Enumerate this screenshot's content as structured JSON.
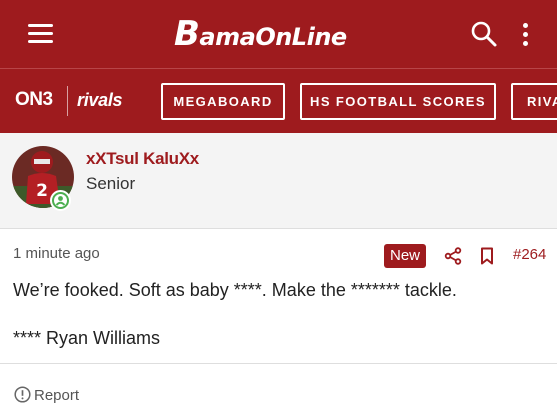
{
  "header": {
    "logo_text": "BamaOnLine",
    "logo_first": "B",
    "logo_rest": "amaOnLine"
  },
  "navbar": {
    "on3_label": "ON3",
    "rivals_label": "rivals",
    "links": [
      "MEGABOARD",
      "HS FOOTBALL SCORES",
      "RIVA"
    ]
  },
  "author": {
    "username": "xXTsul KaluXx",
    "title": "Senior",
    "jersey_number": "2"
  },
  "post": {
    "time": "1 minute ago",
    "badge": "New",
    "number": "#264",
    "lines": [
      "We’re fooked. Soft as baby ****. Make the ******* tackle.",
      "**** Ryan Williams"
    ]
  },
  "footer": {
    "report_label": "Report"
  },
  "colors": {
    "brand": "#9e1b1e",
    "online": "#4caf50"
  }
}
